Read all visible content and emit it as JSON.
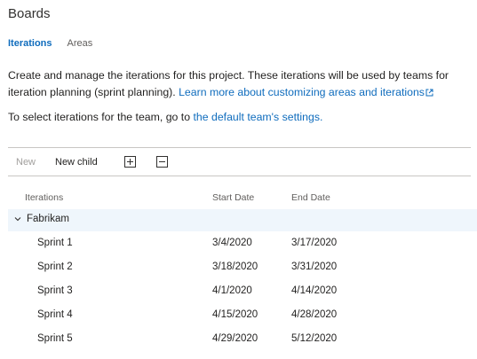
{
  "page": {
    "title": "Boards"
  },
  "tabs": [
    {
      "label": "Iterations",
      "active": true
    },
    {
      "label": "Areas",
      "active": false
    }
  ],
  "description": {
    "text": "Create and manage the iterations for this project. These iterations will be used by teams for iteration planning (sprint planning).",
    "link": "Learn more about customizing areas and iterations"
  },
  "team_note": {
    "text": "To select iterations for the team, go to",
    "link": "the default team's settings."
  },
  "toolbar": {
    "new_label": "New",
    "new_child_label": "New child",
    "expand_icon": "plus-box-icon",
    "collapse_icon": "minus-box-icon"
  },
  "table": {
    "headers": {
      "name": "Iterations",
      "start": "Start Date",
      "end": "End Date"
    },
    "group": {
      "label": "Fabrikam",
      "expanded": true
    },
    "rows": [
      {
        "name": "Sprint 1",
        "start": "3/4/2020",
        "end": "3/17/2020"
      },
      {
        "name": "Sprint 2",
        "start": "3/18/2020",
        "end": "3/31/2020"
      },
      {
        "name": "Sprint 3",
        "start": "4/1/2020",
        "end": "4/14/2020"
      },
      {
        "name": "Sprint 4",
        "start": "4/15/2020",
        "end": "4/28/2020"
      },
      {
        "name": "Sprint 5",
        "start": "4/29/2020",
        "end": "5/12/2020"
      }
    ]
  },
  "colors": {
    "accent": "#0f6cbd",
    "group_row_bg": "#eff6fc",
    "disabled_text": "#a19f9d"
  }
}
